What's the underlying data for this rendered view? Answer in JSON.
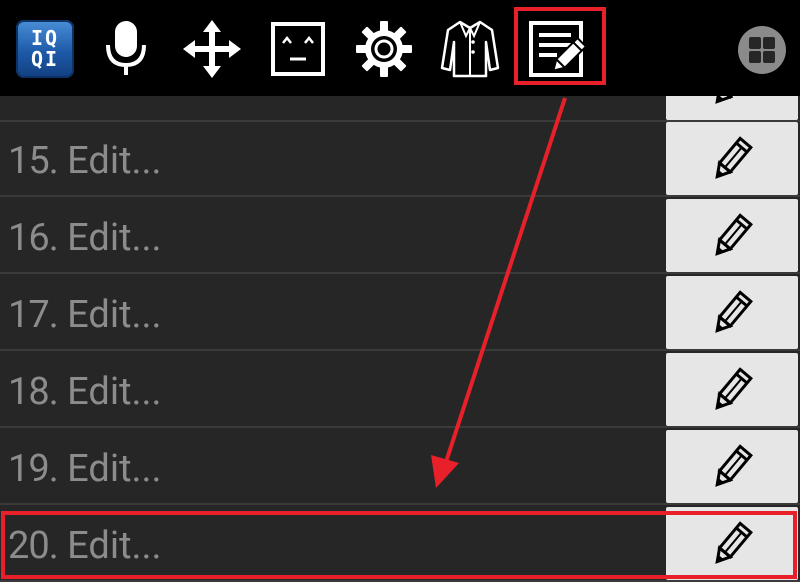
{
  "toolbar": {
    "logo_text_top": "IQ",
    "logo_text_bottom": "QI",
    "icons": [
      "app-logo-icon",
      "microphone-icon",
      "move-arrows-icon",
      "emoji-face-icon",
      "gear-icon",
      "shirt-icon",
      "notepad-edit-icon",
      "grid-layout-icon"
    ]
  },
  "rows": [
    {
      "number": "15.",
      "label": "Edit..."
    },
    {
      "number": "16.",
      "label": "Edit..."
    },
    {
      "number": "17.",
      "label": "Edit..."
    },
    {
      "number": "18.",
      "label": "Edit..."
    },
    {
      "number": "19.",
      "label": "Edit..."
    },
    {
      "number": "20.",
      "label": "Edit..."
    }
  ],
  "colors": {
    "highlight": "#e8202a",
    "background": "#262626",
    "edit_button": "#e6e6e6",
    "label": "#8c8c8c"
  }
}
